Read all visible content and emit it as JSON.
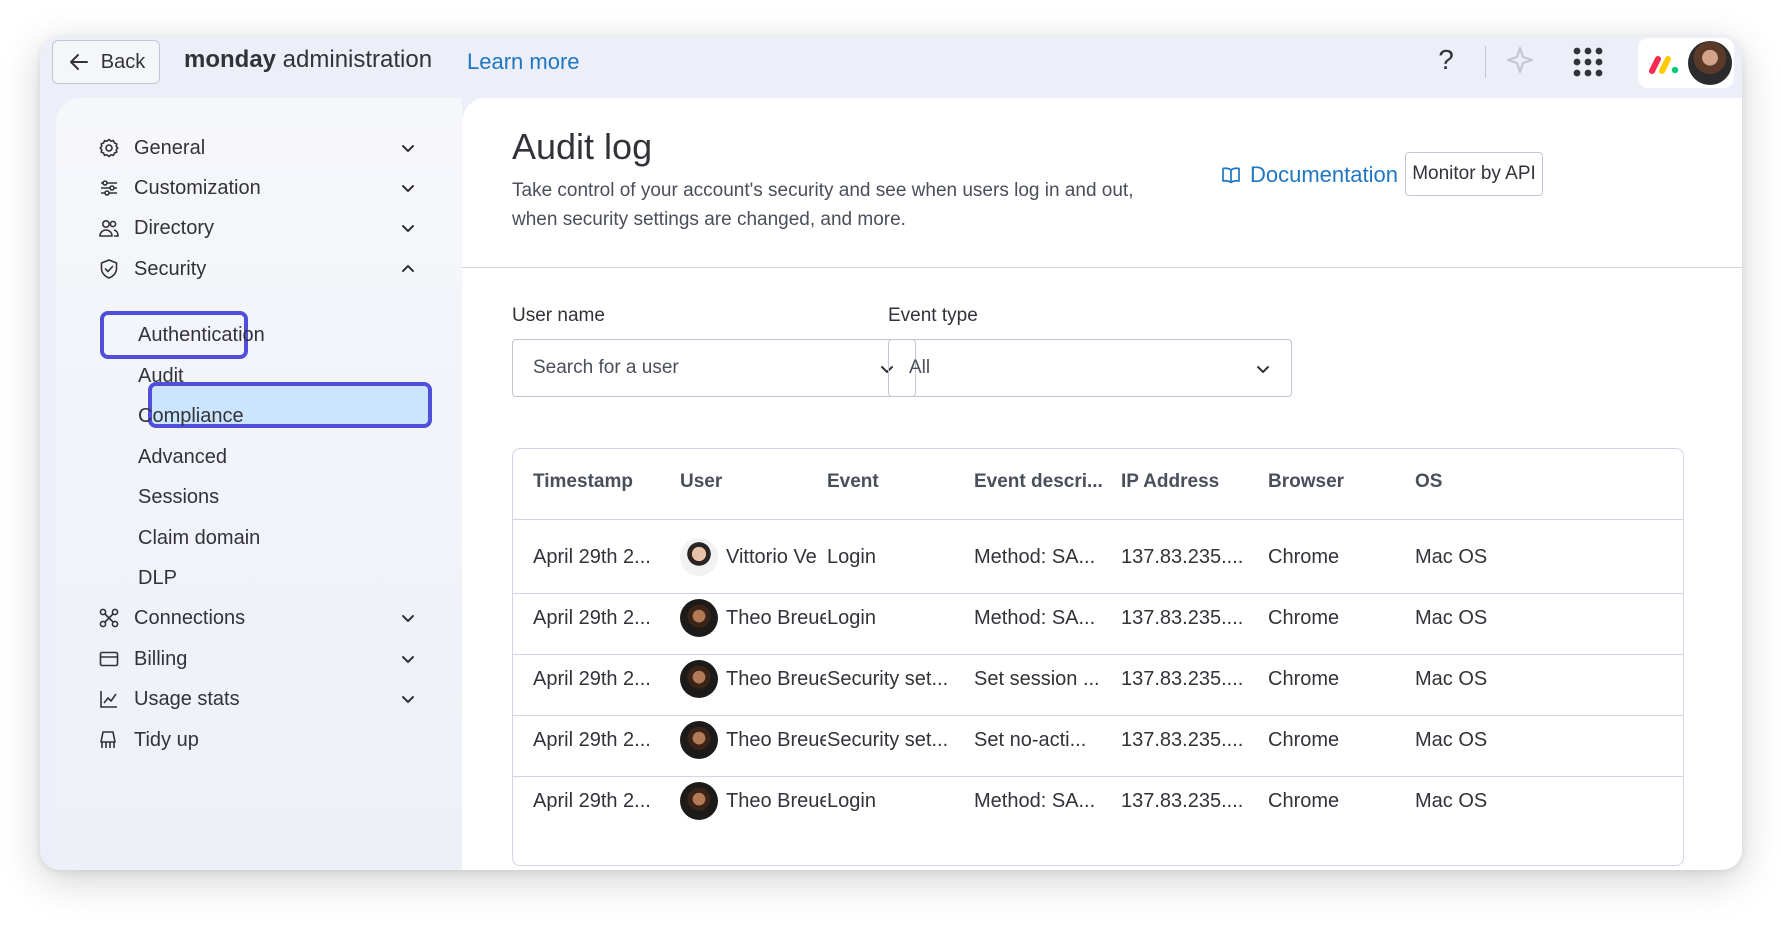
{
  "topbar": {
    "back_label": "Back",
    "app_name_bold": "monday",
    "app_name_rest": " administration",
    "learn_more": "Learn more",
    "help_label": "?"
  },
  "sidebar": {
    "items": [
      {
        "label": "General",
        "icon": "gear-icon"
      },
      {
        "label": "Customization",
        "icon": "sliders-icon"
      },
      {
        "label": "Directory",
        "icon": "users-icon"
      },
      {
        "label": "Security",
        "icon": "shield-icon"
      },
      {
        "label": "Connections",
        "icon": "connections-icon"
      },
      {
        "label": "Billing",
        "icon": "card-icon"
      },
      {
        "label": "Usage stats",
        "icon": "chart-icon"
      },
      {
        "label": "Tidy up",
        "icon": "broom-icon"
      }
    ],
    "security_sub": [
      "Authentication",
      "Audit",
      "Compliance",
      "Advanced",
      "Sessions",
      "Claim domain",
      "DLP"
    ]
  },
  "main": {
    "title": "Audit log",
    "description": "Take control of your account's security and see when users log in and out, when security settings are changed, and more.",
    "documentation_link": "Documentation",
    "monitor_button": "Monitor by API",
    "filters": {
      "user_label": "User name",
      "user_placeholder": "Search for a user",
      "event_label": "Event type",
      "event_value": "All"
    },
    "table": {
      "columns": [
        "Timestamp",
        "User",
        "Event",
        "Event descri...",
        "IP Address",
        "Browser",
        "OS"
      ],
      "rows": [
        {
          "timestamp": "April 29th 2...",
          "user": "Vittorio Ve",
          "event": "Login",
          "description": "Method: SA...",
          "ip": "137.83.235....",
          "browser": "Chrome",
          "os": "Mac OS"
        },
        {
          "timestamp": "April 29th 2...",
          "user": "Theo Breue",
          "event": "Login",
          "description": "Method: SA...",
          "ip": "137.83.235....",
          "browser": "Chrome",
          "os": "Mac OS"
        },
        {
          "timestamp": "April 29th 2...",
          "user": "Theo Breue",
          "event": "Security set...",
          "description": "Set session ...",
          "ip": "137.83.235....",
          "browser": "Chrome",
          "os": "Mac OS"
        },
        {
          "timestamp": "April 29th 2...",
          "user": "Theo Breue",
          "event": "Security set...",
          "description": "Set no-acti...",
          "ip": "137.83.235....",
          "browser": "Chrome",
          "os": "Mac OS"
        },
        {
          "timestamp": "April 29th 2...",
          "user": "Theo Breue",
          "event": "Login",
          "description": "Method: SA...",
          "ip": "137.83.235....",
          "browser": "Chrome",
          "os": "Mac OS"
        }
      ]
    }
  },
  "colors": {
    "accent_link": "#1f76c2",
    "highlight_border": "#4f4fd9",
    "selected_bg": "#cce5ff"
  }
}
